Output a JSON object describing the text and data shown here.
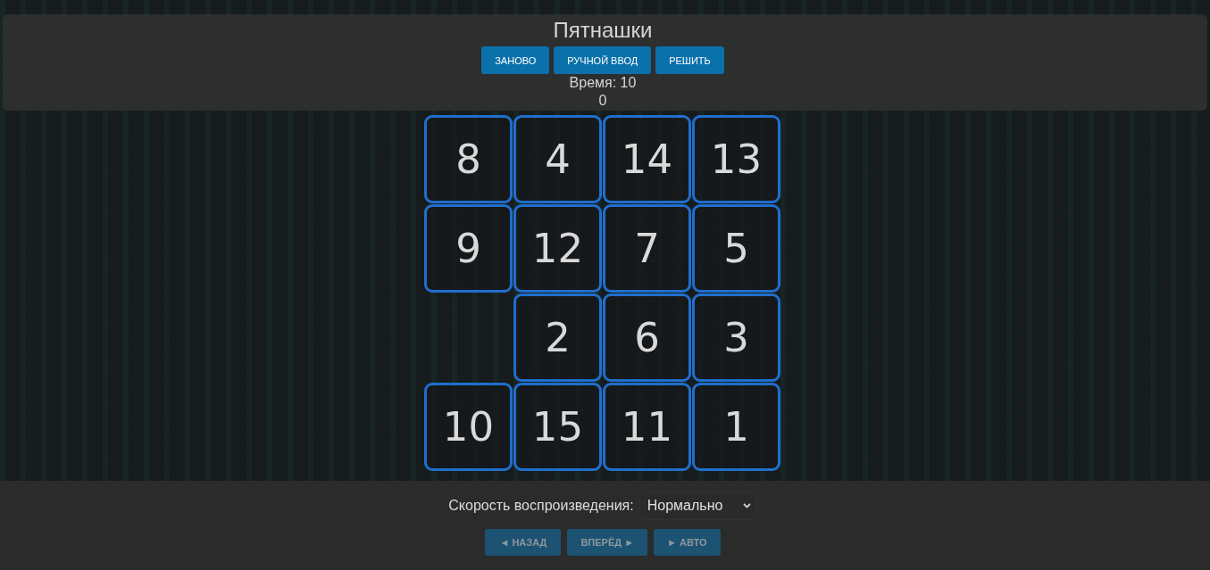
{
  "title": "Пятнашки",
  "actions": [
    {
      "label": "ЗАНОВО",
      "disabled": false
    },
    {
      "label": "РУЧНОЙ ВВОД",
      "disabled": false
    },
    {
      "label": "РЕШИТЬ",
      "disabled": false
    }
  ],
  "timer": {
    "lines": [
      "Время: 10",
      "0"
    ]
  },
  "board": {
    "tiles": [
      {
        "kind": "tile",
        "label": "8"
      },
      {
        "kind": "tile",
        "label": "4"
      },
      {
        "kind": "tile",
        "label": "14"
      },
      {
        "kind": "tile",
        "label": "13"
      },
      {
        "kind": "tile",
        "label": "9"
      },
      {
        "kind": "tile",
        "label": "12"
      },
      {
        "kind": "tile",
        "label": "7"
      },
      {
        "kind": "tile",
        "label": "5"
      },
      {
        "kind": "empty"
      },
      {
        "kind": "tile",
        "label": "2"
      },
      {
        "kind": "tile",
        "label": "6"
      },
      {
        "kind": "tile",
        "label": "3"
      },
      {
        "kind": "tile",
        "label": "10"
      },
      {
        "kind": "tile",
        "label": "15"
      },
      {
        "kind": "tile",
        "label": "11"
      },
      {
        "kind": "tile",
        "label": "1"
      }
    ]
  },
  "playback": {
    "speed": {
      "label": "Скорость воспроизведения:",
      "value": "Нормально"
    },
    "buttons": [
      {
        "label": "◄ НАЗАД",
        "disabled": true
      },
      {
        "label": "ВПЕРЁД ►",
        "disabled": true
      },
      {
        "label": "► АВТО",
        "disabled": true
      }
    ]
  }
}
